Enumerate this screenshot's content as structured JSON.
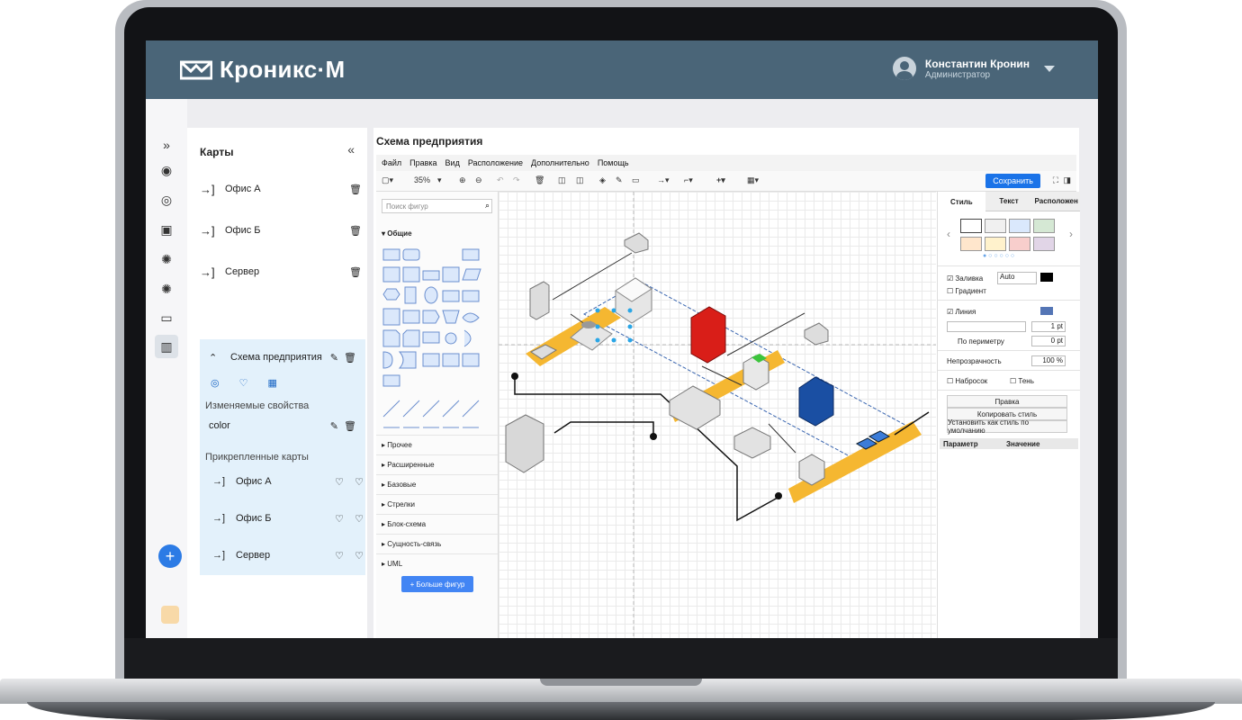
{
  "brand": {
    "logo_text": "Кроникс·М"
  },
  "user": {
    "name": "Константин Кронин",
    "role": "Администратор"
  },
  "sidebar": {
    "title": "Карты",
    "maps": [
      {
        "label": "Офис А"
      },
      {
        "label": "Офис Б"
      },
      {
        "label": "Сервер"
      }
    ],
    "expanded": {
      "label": "Схема предприятия",
      "editable_props_title": "Изменяемые свойства",
      "prop": "color",
      "attached_title": "Прикрепленные карты",
      "attached": [
        {
          "label": "Офис А"
        },
        {
          "label": "Офис Б"
        },
        {
          "label": "Сервер"
        }
      ]
    }
  },
  "editor": {
    "title": "Схема предприятия",
    "menu": [
      "Файл",
      "Правка",
      "Вид",
      "Расположение",
      "Дополнительно",
      "Помощь"
    ],
    "zoom": "35%",
    "save_label": "Сохранить",
    "search_placeholder": "Поиск фигур",
    "sections": [
      "Общие",
      "Прочее",
      "Расширенные",
      "Базовые",
      "Стрелки",
      "Блок-схема",
      "Сущность-связь",
      "UML"
    ],
    "more_shapes": "+ Больше фигур"
  },
  "props": {
    "tabs": [
      "Стиль",
      "Текст",
      "Расположен"
    ],
    "fill_label": "Заливка",
    "fill_value": "Auto",
    "gradient_label": "Градиент",
    "line_label": "Линия",
    "line_width": "1 pt",
    "perimeter_label": "По периметру",
    "perimeter_value": "0 pt",
    "opacity_label": "Непрозрачность",
    "opacity_value": "100 %",
    "sketch_label": "Набросок",
    "shadow_label": "Тень",
    "edit_style": "Правка",
    "copy_style": "Копировать стиль",
    "set_default": "Установить как стиль по умолчанию",
    "param_col": "Параметр",
    "value_col": "Значение"
  },
  "colors": {
    "header": "#4a6578",
    "accent": "#2c7be5",
    "path": "#f5b731"
  }
}
